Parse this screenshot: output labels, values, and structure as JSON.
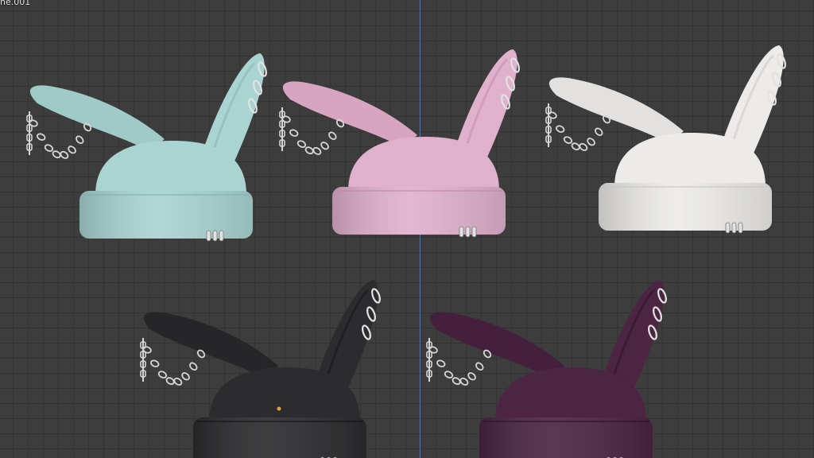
{
  "viewport": {
    "object_label": "ne.001",
    "background": "#3d3d3d",
    "grid_color": "#333333",
    "axis_color": "#5a7fb8"
  },
  "hats": [
    {
      "name": "mint",
      "color": "#a9d4d2",
      "shade": "#82b1ad",
      "ear_inner": "#9fcac7"
    },
    {
      "name": "pink",
      "color": "#e0b1cd",
      "shade": "#c08aa9",
      "ear_inner": "#d7a5c2"
    },
    {
      "name": "white",
      "color": "#ecebe9",
      "shade": "#c7c6c3",
      "ear_inner": "#e2e1df"
    },
    {
      "name": "black",
      "color": "#2c2c2e",
      "shade": "#141415",
      "ear_inner": "#262628"
    },
    {
      "name": "purple",
      "color": "#4b2542",
      "shade": "#2c1227",
      "ear_inner": "#45203c"
    }
  ],
  "accessories": {
    "chain_color": "#d6d6d6",
    "ring_color": "#e2e2e2",
    "stud_color": "#f0a030"
  }
}
